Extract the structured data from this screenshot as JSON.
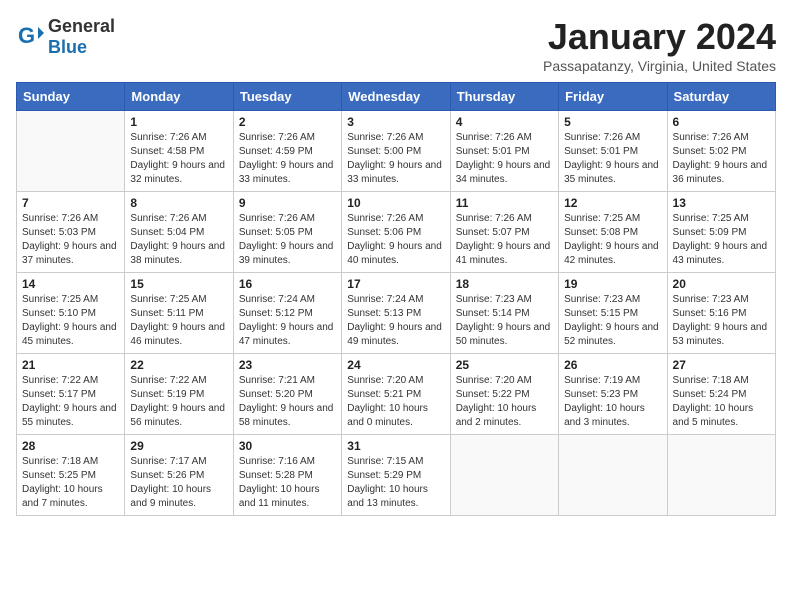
{
  "header": {
    "logo_general": "General",
    "logo_blue": "Blue",
    "title": "January 2024",
    "subtitle": "Passapatanzy, Virginia, United States"
  },
  "days": [
    "Sunday",
    "Monday",
    "Tuesday",
    "Wednesday",
    "Thursday",
    "Friday",
    "Saturday"
  ],
  "weeks": [
    [
      {
        "date": "",
        "sunrise": "",
        "sunset": "",
        "daylight": ""
      },
      {
        "date": "1",
        "sunrise": "Sunrise: 7:26 AM",
        "sunset": "Sunset: 4:58 PM",
        "daylight": "Daylight: 9 hours and 32 minutes."
      },
      {
        "date": "2",
        "sunrise": "Sunrise: 7:26 AM",
        "sunset": "Sunset: 4:59 PM",
        "daylight": "Daylight: 9 hours and 33 minutes."
      },
      {
        "date": "3",
        "sunrise": "Sunrise: 7:26 AM",
        "sunset": "Sunset: 5:00 PM",
        "daylight": "Daylight: 9 hours and 33 minutes."
      },
      {
        "date": "4",
        "sunrise": "Sunrise: 7:26 AM",
        "sunset": "Sunset: 5:01 PM",
        "daylight": "Daylight: 9 hours and 34 minutes."
      },
      {
        "date": "5",
        "sunrise": "Sunrise: 7:26 AM",
        "sunset": "Sunset: 5:01 PM",
        "daylight": "Daylight: 9 hours and 35 minutes."
      },
      {
        "date": "6",
        "sunrise": "Sunrise: 7:26 AM",
        "sunset": "Sunset: 5:02 PM",
        "daylight": "Daylight: 9 hours and 36 minutes."
      }
    ],
    [
      {
        "date": "7",
        "sunrise": "Sunrise: 7:26 AM",
        "sunset": "Sunset: 5:03 PM",
        "daylight": "Daylight: 9 hours and 37 minutes."
      },
      {
        "date": "8",
        "sunrise": "Sunrise: 7:26 AM",
        "sunset": "Sunset: 5:04 PM",
        "daylight": "Daylight: 9 hours and 38 minutes."
      },
      {
        "date": "9",
        "sunrise": "Sunrise: 7:26 AM",
        "sunset": "Sunset: 5:05 PM",
        "daylight": "Daylight: 9 hours and 39 minutes."
      },
      {
        "date": "10",
        "sunrise": "Sunrise: 7:26 AM",
        "sunset": "Sunset: 5:06 PM",
        "daylight": "Daylight: 9 hours and 40 minutes."
      },
      {
        "date": "11",
        "sunrise": "Sunrise: 7:26 AM",
        "sunset": "Sunset: 5:07 PM",
        "daylight": "Daylight: 9 hours and 41 minutes."
      },
      {
        "date": "12",
        "sunrise": "Sunrise: 7:25 AM",
        "sunset": "Sunset: 5:08 PM",
        "daylight": "Daylight: 9 hours and 42 minutes."
      },
      {
        "date": "13",
        "sunrise": "Sunrise: 7:25 AM",
        "sunset": "Sunset: 5:09 PM",
        "daylight": "Daylight: 9 hours and 43 minutes."
      }
    ],
    [
      {
        "date": "14",
        "sunrise": "Sunrise: 7:25 AM",
        "sunset": "Sunset: 5:10 PM",
        "daylight": "Daylight: 9 hours and 45 minutes."
      },
      {
        "date": "15",
        "sunrise": "Sunrise: 7:25 AM",
        "sunset": "Sunset: 5:11 PM",
        "daylight": "Daylight: 9 hours and 46 minutes."
      },
      {
        "date": "16",
        "sunrise": "Sunrise: 7:24 AM",
        "sunset": "Sunset: 5:12 PM",
        "daylight": "Daylight: 9 hours and 47 minutes."
      },
      {
        "date": "17",
        "sunrise": "Sunrise: 7:24 AM",
        "sunset": "Sunset: 5:13 PM",
        "daylight": "Daylight: 9 hours and 49 minutes."
      },
      {
        "date": "18",
        "sunrise": "Sunrise: 7:23 AM",
        "sunset": "Sunset: 5:14 PM",
        "daylight": "Daylight: 9 hours and 50 minutes."
      },
      {
        "date": "19",
        "sunrise": "Sunrise: 7:23 AM",
        "sunset": "Sunset: 5:15 PM",
        "daylight": "Daylight: 9 hours and 52 minutes."
      },
      {
        "date": "20",
        "sunrise": "Sunrise: 7:23 AM",
        "sunset": "Sunset: 5:16 PM",
        "daylight": "Daylight: 9 hours and 53 minutes."
      }
    ],
    [
      {
        "date": "21",
        "sunrise": "Sunrise: 7:22 AM",
        "sunset": "Sunset: 5:17 PM",
        "daylight": "Daylight: 9 hours and 55 minutes."
      },
      {
        "date": "22",
        "sunrise": "Sunrise: 7:22 AM",
        "sunset": "Sunset: 5:19 PM",
        "daylight": "Daylight: 9 hours and 56 minutes."
      },
      {
        "date": "23",
        "sunrise": "Sunrise: 7:21 AM",
        "sunset": "Sunset: 5:20 PM",
        "daylight": "Daylight: 9 hours and 58 minutes."
      },
      {
        "date": "24",
        "sunrise": "Sunrise: 7:20 AM",
        "sunset": "Sunset: 5:21 PM",
        "daylight": "Daylight: 10 hours and 0 minutes."
      },
      {
        "date": "25",
        "sunrise": "Sunrise: 7:20 AM",
        "sunset": "Sunset: 5:22 PM",
        "daylight": "Daylight: 10 hours and 2 minutes."
      },
      {
        "date": "26",
        "sunrise": "Sunrise: 7:19 AM",
        "sunset": "Sunset: 5:23 PM",
        "daylight": "Daylight: 10 hours and 3 minutes."
      },
      {
        "date": "27",
        "sunrise": "Sunrise: 7:18 AM",
        "sunset": "Sunset: 5:24 PM",
        "daylight": "Daylight: 10 hours and 5 minutes."
      }
    ],
    [
      {
        "date": "28",
        "sunrise": "Sunrise: 7:18 AM",
        "sunset": "Sunset: 5:25 PM",
        "daylight": "Daylight: 10 hours and 7 minutes."
      },
      {
        "date": "29",
        "sunrise": "Sunrise: 7:17 AM",
        "sunset": "Sunset: 5:26 PM",
        "daylight": "Daylight: 10 hours and 9 minutes."
      },
      {
        "date": "30",
        "sunrise": "Sunrise: 7:16 AM",
        "sunset": "Sunset: 5:28 PM",
        "daylight": "Daylight: 10 hours and 11 minutes."
      },
      {
        "date": "31",
        "sunrise": "Sunrise: 7:15 AM",
        "sunset": "Sunset: 5:29 PM",
        "daylight": "Daylight: 10 hours and 13 minutes."
      },
      {
        "date": "",
        "sunrise": "",
        "sunset": "",
        "daylight": ""
      },
      {
        "date": "",
        "sunrise": "",
        "sunset": "",
        "daylight": ""
      },
      {
        "date": "",
        "sunrise": "",
        "sunset": "",
        "daylight": ""
      }
    ]
  ]
}
